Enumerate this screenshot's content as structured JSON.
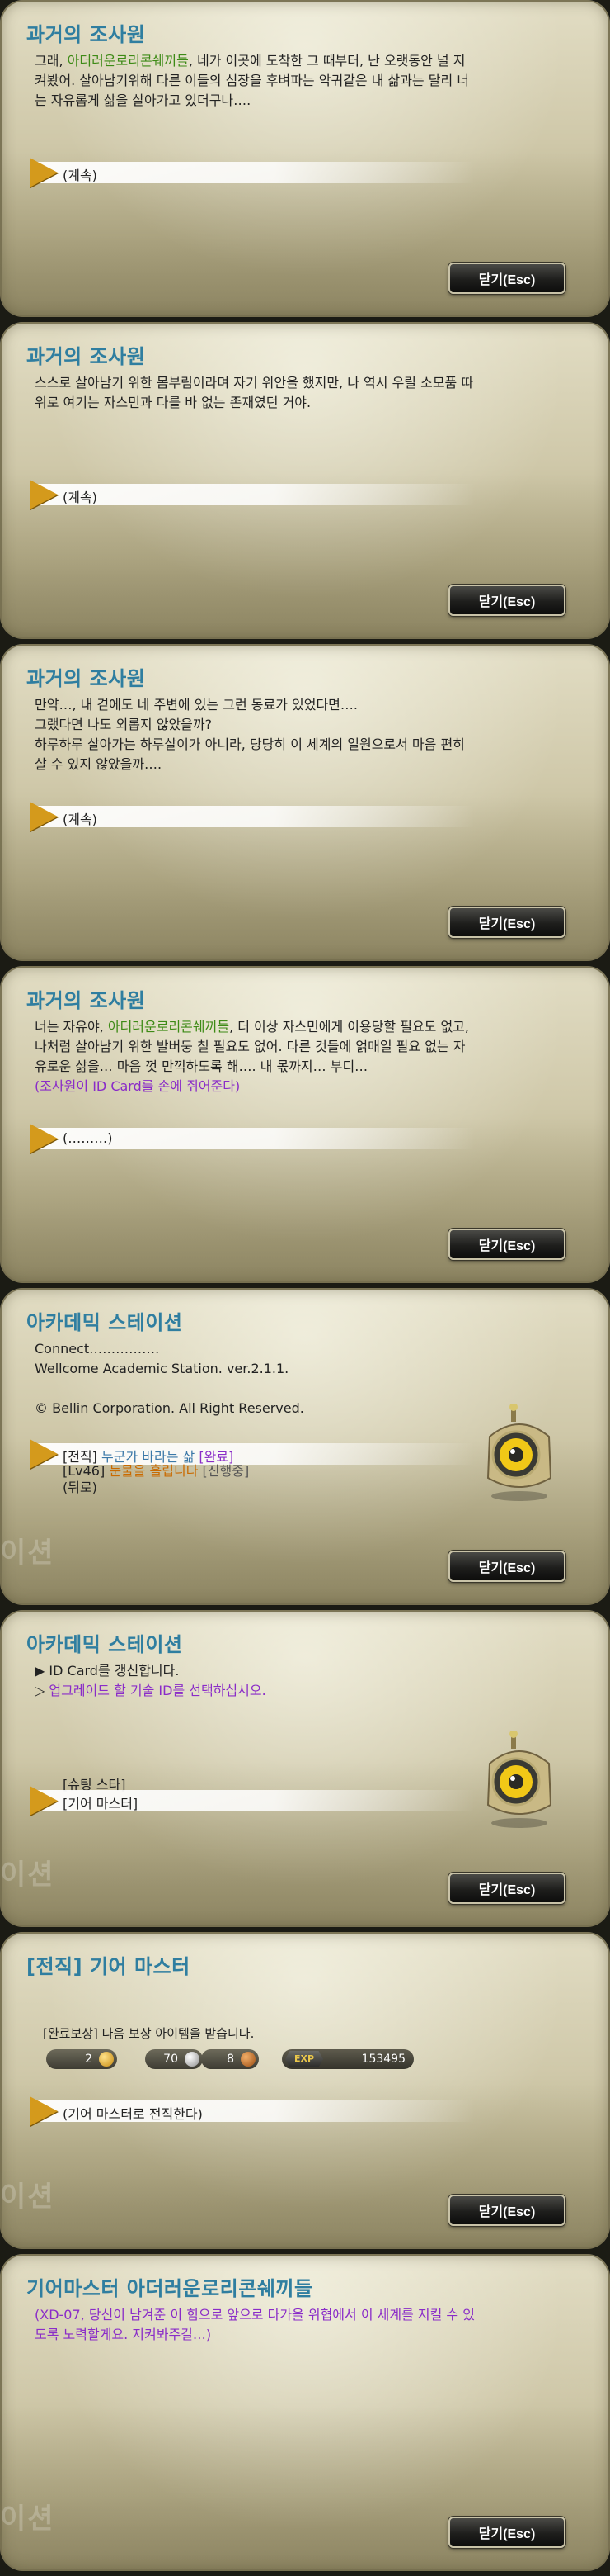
{
  "dialogs": [
    {
      "title": "과거의 조사원",
      "lines": [
        [
          {
            "t": "그래, "
          },
          {
            "t": "아더러운로리콘쉐끼들",
            "c": "green"
          },
          {
            "t": ", 네가 이곳에 도착한 그 때부터, 난 오랫동안 널 지"
          }
        ],
        [
          {
            "t": "켜봤어. 살아남기위해 다른 이들의 심장을 후벼파는 악귀같은 내 삶과는 달리 너"
          }
        ],
        [
          {
            "t": "는 자유롭게 삶을 살아가고 있더구나…."
          }
        ]
      ],
      "choices": [
        {
          "label": "(계속)",
          "selected": true
        }
      ],
      "close": "닫기(Esc)"
    },
    {
      "title": "과거의 조사원",
      "lines": [
        [
          {
            "t": "스스로 살아남기 위한 몸부림이라며 자기 위안을 했지만, 나 역시 우릴 소모품 따"
          }
        ],
        [
          {
            "t": "위로 여기는 자스민과 다를 바 없는 존재였던 거야."
          }
        ]
      ],
      "choices": [
        {
          "label": "(계속)",
          "selected": true
        }
      ],
      "close": "닫기(Esc)"
    },
    {
      "title": "과거의 조사원",
      "lines": [
        [
          {
            "t": "만약…, 내 곁에도 네 주변에 있는 그런 동료가 있었다면…."
          }
        ],
        [
          {
            "t": "그랬다면 나도 외롭지 않았을까?"
          }
        ],
        [
          {
            "t": "하루하루 살아가는 하루살이가 아니라, 당당히 이 세계의 일원으로서 마음 편히"
          }
        ],
        [
          {
            "t": "살 수 있지 않았을까…."
          }
        ]
      ],
      "choices": [
        {
          "label": "(계속)",
          "selected": true
        }
      ],
      "close": "닫기(Esc)"
    },
    {
      "title": "과거의 조사원",
      "lines": [
        [
          {
            "t": "너는 자유야, "
          },
          {
            "t": "아더러운로리콘쉐끼들",
            "c": "green"
          },
          {
            "t": ", 더 이상 자스민에게 이용당할 필요도 없고,"
          }
        ],
        [
          {
            "t": "나처럼 살아남기 위한 발버둥 칠 필요도 없어. 다른 것들에 얽매일 필요 없는 자"
          }
        ],
        [
          {
            "t": "유로운 삶을… 마음 껏 만끽하도록 해…. 내 몫까지… 부디…"
          }
        ],
        [
          {
            "t": "(조사원이 ID Card를 손에 쥐어준다)",
            "c": "purple"
          }
        ]
      ],
      "choices": [
        {
          "label": "(………)",
          "selected": true
        }
      ],
      "close": "닫기(Esc)"
    },
    {
      "title": "아카데믹 스테이션",
      "lines": [
        [
          {
            "t": "Connect……………."
          }
        ],
        [
          {
            "t": "Wellcome Academic Station. ver.2.1.1."
          }
        ],
        [
          {
            "t": ""
          }
        ],
        [
          {
            "t": "© Bellin Corporation. All Right Reserved."
          }
        ]
      ],
      "choices": [
        {
          "label": "",
          "parts": [
            {
              "t": "[전직] "
            },
            {
              "t": "누군가 바라는 삶",
              "c": "blue"
            },
            {
              "t": " "
            },
            {
              "t": "[완료]",
              "c": "purple"
            }
          ],
          "selected": true
        },
        {
          "label": "",
          "parts": [
            {
              "t": "[Lv46] "
            },
            {
              "t": "눈물을 흘립니다",
              "c": "orange"
            },
            {
              "t": " "
            },
            {
              "t": "[진행중]",
              "c": "gray"
            }
          ],
          "selected": false
        },
        {
          "label": "(뒤로)",
          "selected": false
        }
      ],
      "close": "닫기(Esc)"
    },
    {
      "title": "아카데믹 스테이션",
      "lines": [
        [
          {
            "t": "▶ ID Card를 갱신합니다."
          }
        ],
        [
          {
            "t": "▷ "
          },
          {
            "t": "업그레이드 할 기술 ID를 선택하십시오.",
            "c": "purple"
          }
        ]
      ],
      "choices": [
        {
          "label": "[슈팅 스타]",
          "selected": false
        },
        {
          "label": "[기어 마스터]",
          "selected": true
        }
      ],
      "close": "닫기(Esc)"
    },
    {
      "title": "[전직] 기어 마스터",
      "lines": [],
      "reward": {
        "header": "[완료보상] 다음 보상 아이템을 받습니다.",
        "gold": "2",
        "silver": "70",
        "copper": "8",
        "exp_label": "EXP",
        "exp": "153495"
      },
      "choices": [
        {
          "label": "(기어 마스터로 전직한다)",
          "selected": true
        }
      ],
      "close": "닫기(Esc)"
    },
    {
      "title": "기어마스터 아더러운로리콘쉐끼들",
      "lines": [
        [
          {
            "t": "(XD-07, 당신이 남겨준 이 힘으로 앞으로 다가올 위협에서 이 세계를 지킬 수 있",
            "c": "purple"
          }
        ],
        [
          {
            "t": "도록 노력할게요. 지켜봐주길…)",
            "c": "purple"
          }
        ]
      ],
      "choices": [],
      "close": "닫기(Esc)"
    }
  ],
  "watermark": "이션",
  "colors": {
    "title": "#2f7ea0",
    "name": "#3d8a16",
    "narration": "#8a2cc8",
    "arrow": "#d49a1c"
  }
}
